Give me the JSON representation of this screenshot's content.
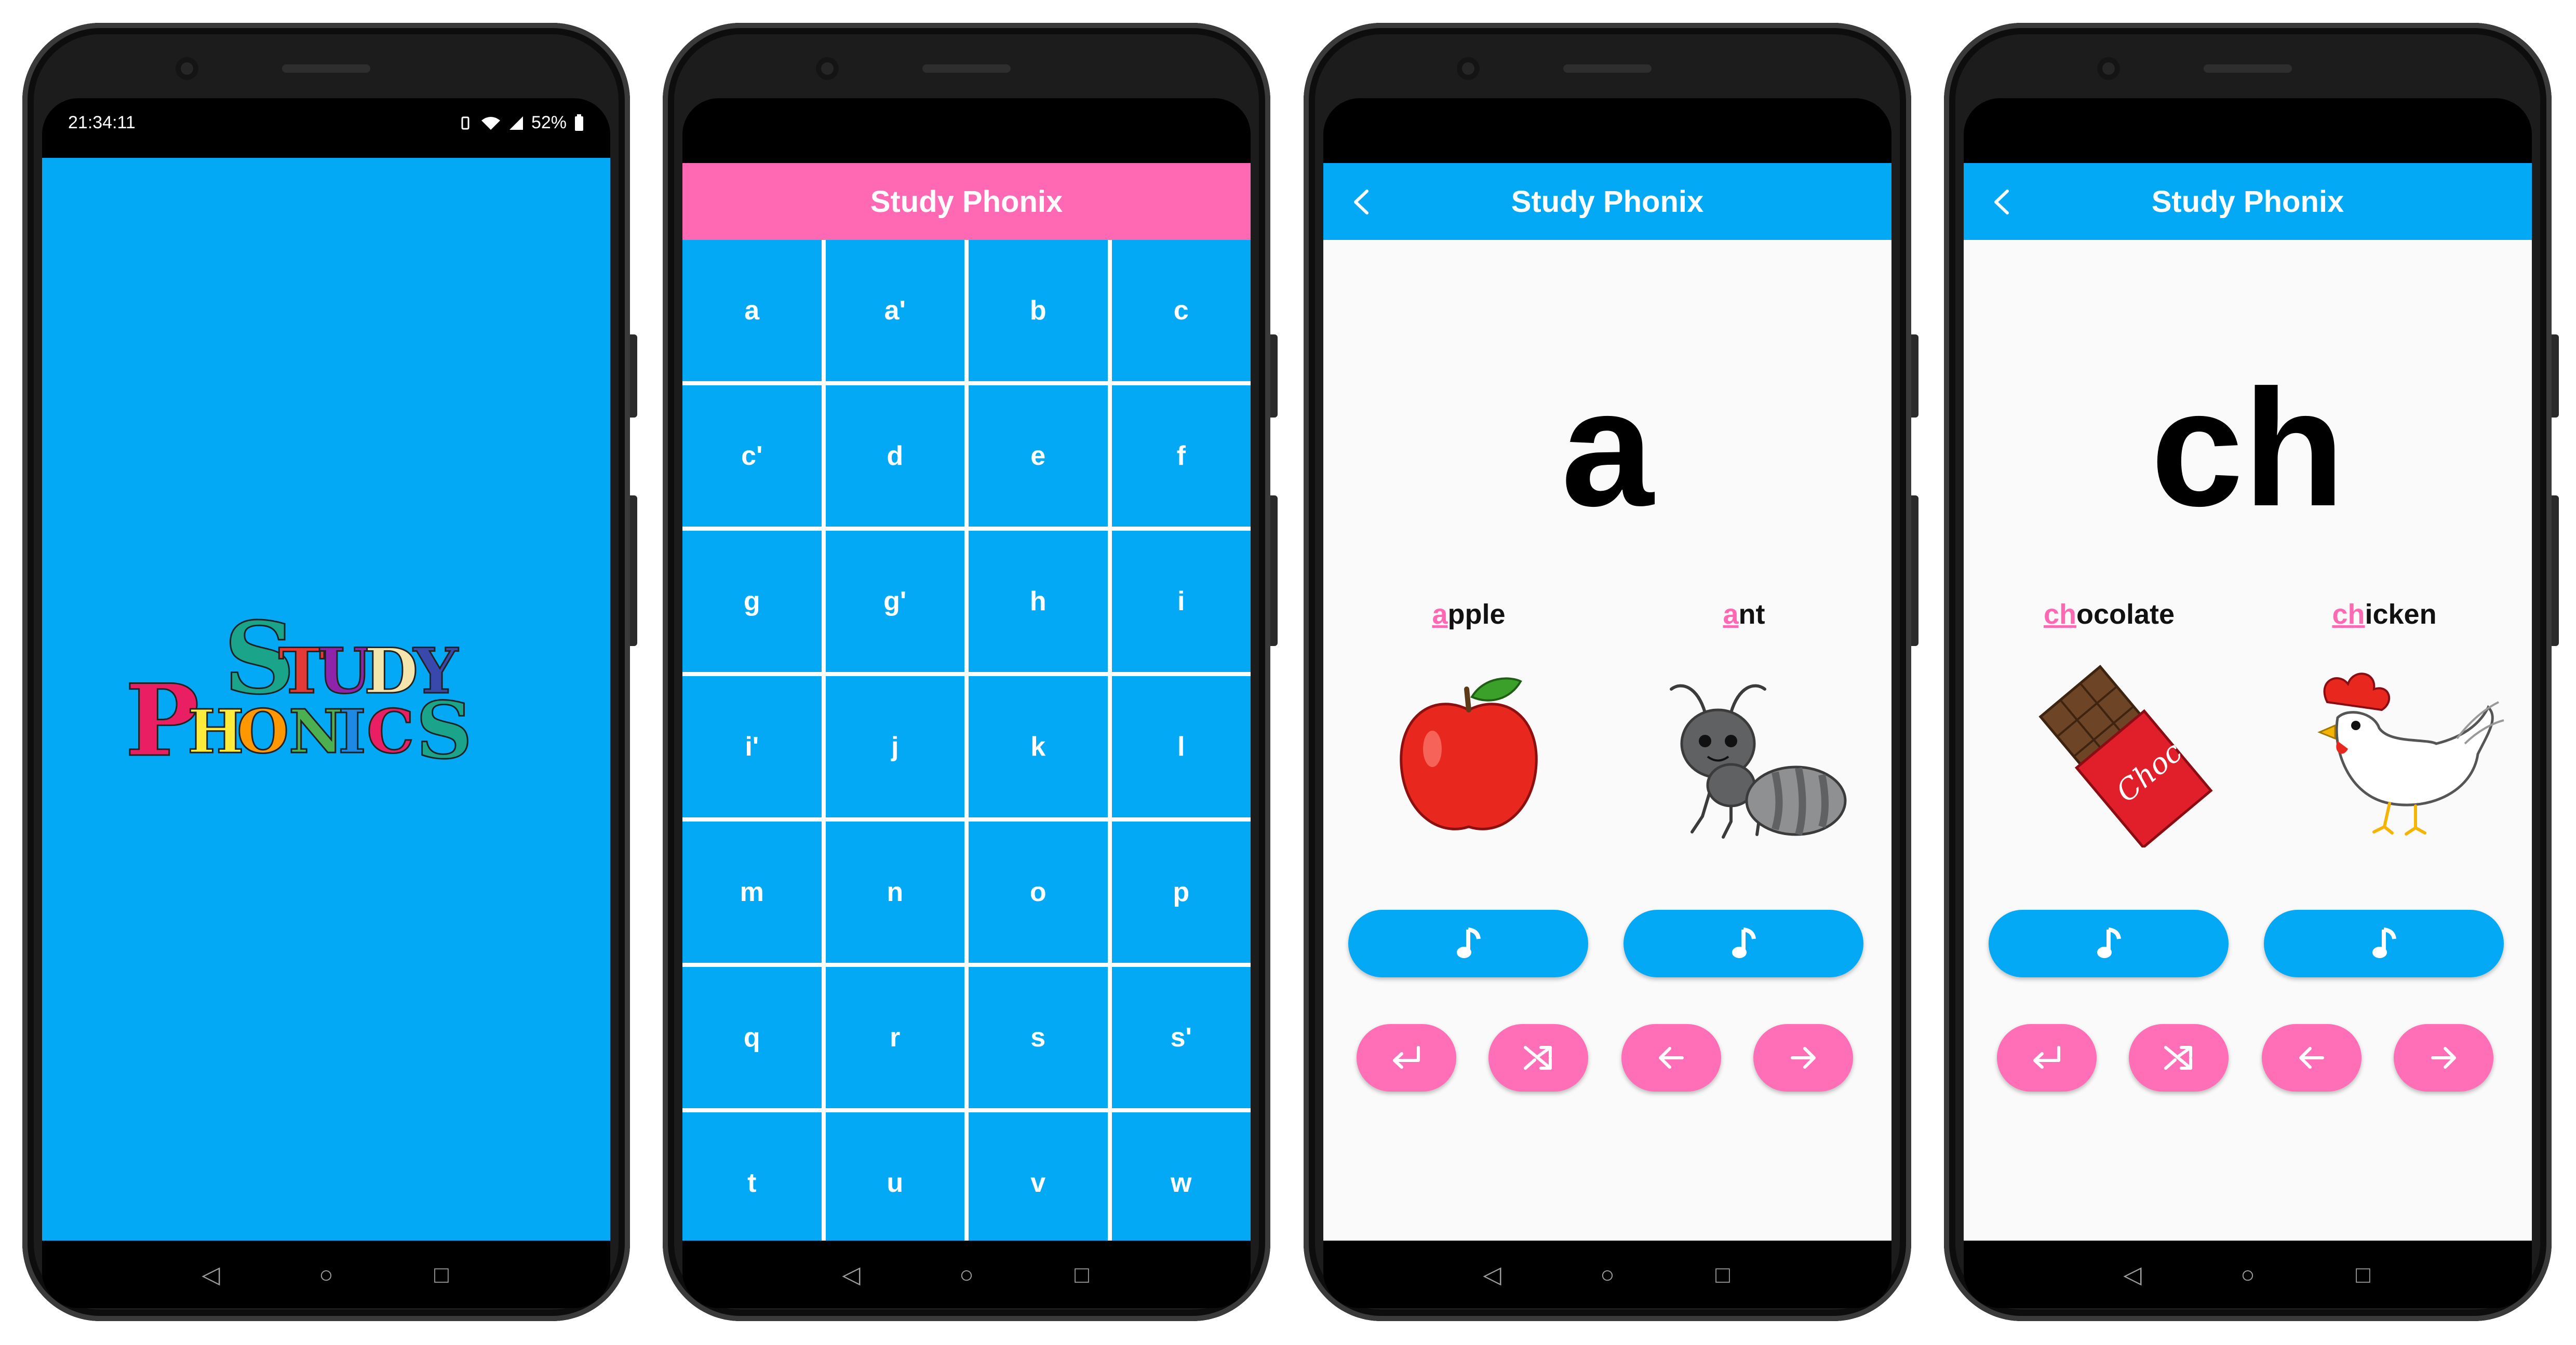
{
  "status": {
    "time": "21:34:11",
    "battery": "52%"
  },
  "app_title": "Study Phonix",
  "logo": {
    "line1": "STUDY",
    "line2": "PHONICS"
  },
  "grid": {
    "cells": [
      "a",
      "a'",
      "b",
      "c",
      "c'",
      "d",
      "e",
      "f",
      "g",
      "g'",
      "h",
      "i",
      "i'",
      "j",
      "k",
      "l",
      "m",
      "n",
      "o",
      "p",
      "q",
      "r",
      "s",
      "s'",
      "t",
      "u",
      "v",
      "w"
    ]
  },
  "detail_a": {
    "letter": "a",
    "left_word": {
      "highlight": "a",
      "rest": "pple"
    },
    "right_word": {
      "highlight": "a",
      "rest": "nt"
    },
    "left_image": "apple",
    "right_image": "ant"
  },
  "detail_ch": {
    "letter": "ch",
    "left_word": {
      "highlight": "ch",
      "rest": "ocolate"
    },
    "right_word": {
      "highlight": "ch",
      "rest": "icken"
    },
    "left_image": "chocolate",
    "right_image": "chicken",
    "wrapper_text": "Choc"
  },
  "icons": {
    "sound": "music-note-icon",
    "return": "return-icon",
    "shuffle": "shuffle-icon",
    "prev": "arrow-left-icon",
    "next": "arrow-right-icon"
  },
  "colors": {
    "blue": "#03a9f4",
    "pink": "#ff69b4"
  }
}
